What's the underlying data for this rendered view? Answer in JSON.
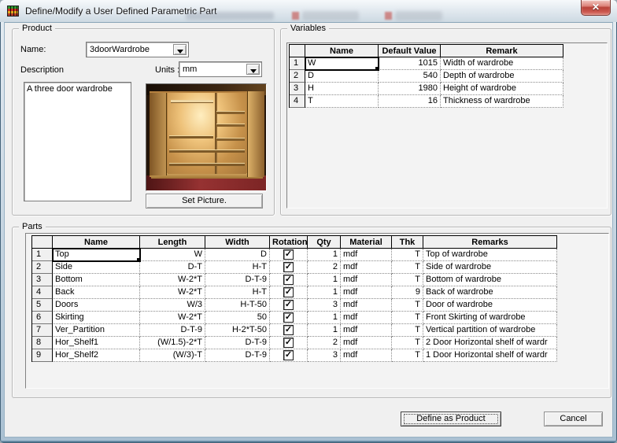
{
  "icons": {
    "close": "✕",
    "check": "✓"
  },
  "window": {
    "title": "Define/Modify a User Defined Parametric Part"
  },
  "product": {
    "label": "Product",
    "name_label": "Name:",
    "name_value": "3doorWardrobe",
    "description_label": "Description",
    "description_value": "A three door wardrobe",
    "units_label": "Units :",
    "units_value": "mm",
    "set_picture_label": "Set Picture.",
    "photo_alt": "wardrobe-photo"
  },
  "variables": {
    "label": "Variables",
    "columns": {
      "num": "",
      "name": "Name",
      "default_value": "Default Value",
      "remark": "Remark"
    },
    "selected": {
      "row": 0,
      "field": "name"
    },
    "rows": [
      {
        "num": "1",
        "name": "W",
        "default_value": "1015",
        "remark": "Width of wardrobe"
      },
      {
        "num": "2",
        "name": "D",
        "default_value": "540",
        "remark": "Depth of wardrobe"
      },
      {
        "num": "3",
        "name": "H",
        "default_value": "1980",
        "remark": "Height of wardrobe"
      },
      {
        "num": "4",
        "name": "T",
        "default_value": "16",
        "remark": "Thickness of wardrobe"
      }
    ]
  },
  "parts": {
    "label": "Parts",
    "columns": {
      "num": "",
      "name": "Name",
      "length": "Length",
      "width": "Width",
      "rotation": "Rotation",
      "qty": "Qty",
      "material": "Material",
      "thk": "Thk",
      "remarks": "Remarks"
    },
    "selected": {
      "row": 0,
      "field": "name"
    },
    "rows": [
      {
        "num": "1",
        "name": "Top",
        "length": "W",
        "width": "D",
        "rotation": true,
        "qty": "1",
        "material": "mdf",
        "thk": "T",
        "remarks": "Top  of wardrobe"
      },
      {
        "num": "2",
        "name": "Side",
        "length": "D-T",
        "width": "H-T",
        "rotation": true,
        "qty": "2",
        "material": "mdf",
        "thk": "T",
        "remarks": "Side of wardrobe"
      },
      {
        "num": "3",
        "name": "Bottom",
        "length": "W-2*T",
        "width": "D-T-9",
        "rotation": true,
        "qty": "1",
        "material": "mdf",
        "thk": "T",
        "remarks": "Bottom of wardrobe"
      },
      {
        "num": "4",
        "name": "Back",
        "length": "W-2*T",
        "width": "H-T",
        "rotation": true,
        "qty": "1",
        "material": "mdf",
        "thk": "9",
        "remarks": "Back of wardrobe"
      },
      {
        "num": "5",
        "name": "Doors",
        "length": "W/3",
        "width": "H-T-50",
        "rotation": true,
        "qty": "3",
        "material": "mdf",
        "thk": "T",
        "remarks": "Door of wardrobe"
      },
      {
        "num": "6",
        "name": "Skirting",
        "length": "W-2*T",
        "width": "50",
        "rotation": true,
        "qty": "1",
        "material": "mdf",
        "thk": "T",
        "remarks": "Front Skirting of wardrobe"
      },
      {
        "num": "7",
        "name": "Ver_Partition",
        "length": "D-T-9",
        "width": "H-2*T-50",
        "rotation": true,
        "qty": "1",
        "material": "mdf",
        "thk": "T",
        "remarks": "Vertical partition of wardrobe"
      },
      {
        "num": "8",
        "name": "Hor_Shelf1",
        "length": "(W/1.5)-2*T",
        "width": "D-T-9",
        "rotation": true,
        "qty": "2",
        "material": "mdf",
        "thk": "T",
        "remarks": "2 Door Horizontal shelf of wardr"
      },
      {
        "num": "9",
        "name": "Hor_Shelf2",
        "length": "(W/3)-T",
        "width": "D-T-9",
        "rotation": true,
        "qty": "3",
        "material": "mdf",
        "thk": "T",
        "remarks": "1 Door Horizontal shelf of wardr"
      }
    ]
  },
  "footer": {
    "define_label": "Define as Product",
    "cancel_label": "Cancel"
  },
  "colors": {
    "dialog_bg": "#f0f0f0",
    "frame_blue": "#a9c0d2",
    "close_red": "#b84238",
    "carpet_red": "#963232",
    "wood": "#c09452"
  }
}
